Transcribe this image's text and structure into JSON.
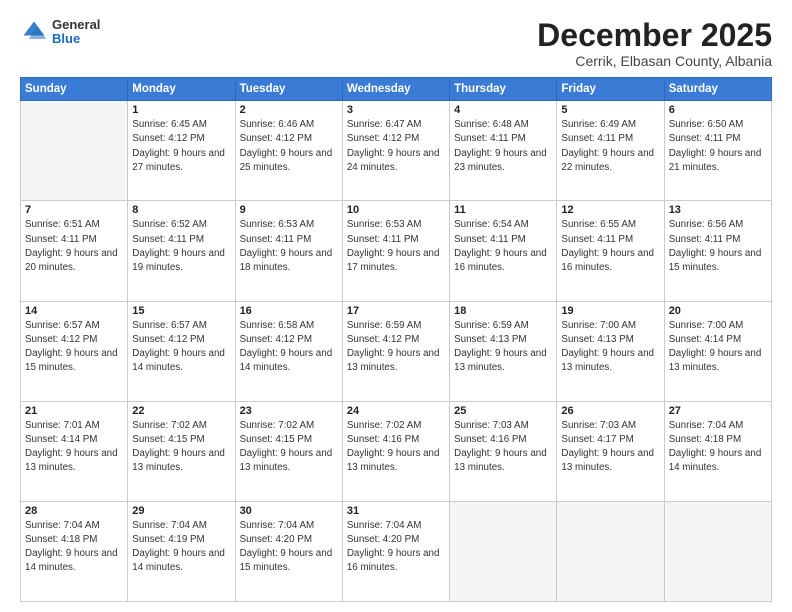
{
  "logo": {
    "general": "General",
    "blue": "Blue"
  },
  "header": {
    "month": "December 2025",
    "location": "Cerrik, Elbasan County, Albania"
  },
  "weekdays": [
    "Sunday",
    "Monday",
    "Tuesday",
    "Wednesday",
    "Thursday",
    "Friday",
    "Saturday"
  ],
  "weeks": [
    [
      {
        "day": "",
        "empty": true
      },
      {
        "day": "1",
        "sunrise": "6:45 AM",
        "sunset": "4:12 PM",
        "daylight": "9 hours and 27 minutes."
      },
      {
        "day": "2",
        "sunrise": "6:46 AM",
        "sunset": "4:12 PM",
        "daylight": "9 hours and 25 minutes."
      },
      {
        "day": "3",
        "sunrise": "6:47 AM",
        "sunset": "4:12 PM",
        "daylight": "9 hours and 24 minutes."
      },
      {
        "day": "4",
        "sunrise": "6:48 AM",
        "sunset": "4:11 PM",
        "daylight": "9 hours and 23 minutes."
      },
      {
        "day": "5",
        "sunrise": "6:49 AM",
        "sunset": "4:11 PM",
        "daylight": "9 hours and 22 minutes."
      },
      {
        "day": "6",
        "sunrise": "6:50 AM",
        "sunset": "4:11 PM",
        "daylight": "9 hours and 21 minutes."
      }
    ],
    [
      {
        "day": "7",
        "sunrise": "6:51 AM",
        "sunset": "4:11 PM",
        "daylight": "9 hours and 20 minutes."
      },
      {
        "day": "8",
        "sunrise": "6:52 AM",
        "sunset": "4:11 PM",
        "daylight": "9 hours and 19 minutes."
      },
      {
        "day": "9",
        "sunrise": "6:53 AM",
        "sunset": "4:11 PM",
        "daylight": "9 hours and 18 minutes."
      },
      {
        "day": "10",
        "sunrise": "6:53 AM",
        "sunset": "4:11 PM",
        "daylight": "9 hours and 17 minutes."
      },
      {
        "day": "11",
        "sunrise": "6:54 AM",
        "sunset": "4:11 PM",
        "daylight": "9 hours and 16 minutes."
      },
      {
        "day": "12",
        "sunrise": "6:55 AM",
        "sunset": "4:11 PM",
        "daylight": "9 hours and 16 minutes."
      },
      {
        "day": "13",
        "sunrise": "6:56 AM",
        "sunset": "4:11 PM",
        "daylight": "9 hours and 15 minutes."
      }
    ],
    [
      {
        "day": "14",
        "sunrise": "6:57 AM",
        "sunset": "4:12 PM",
        "daylight": "9 hours and 15 minutes."
      },
      {
        "day": "15",
        "sunrise": "6:57 AM",
        "sunset": "4:12 PM",
        "daylight": "9 hours and 14 minutes."
      },
      {
        "day": "16",
        "sunrise": "6:58 AM",
        "sunset": "4:12 PM",
        "daylight": "9 hours and 14 minutes."
      },
      {
        "day": "17",
        "sunrise": "6:59 AM",
        "sunset": "4:12 PM",
        "daylight": "9 hours and 13 minutes."
      },
      {
        "day": "18",
        "sunrise": "6:59 AM",
        "sunset": "4:13 PM",
        "daylight": "9 hours and 13 minutes."
      },
      {
        "day": "19",
        "sunrise": "7:00 AM",
        "sunset": "4:13 PM",
        "daylight": "9 hours and 13 minutes."
      },
      {
        "day": "20",
        "sunrise": "7:00 AM",
        "sunset": "4:14 PM",
        "daylight": "9 hours and 13 minutes."
      }
    ],
    [
      {
        "day": "21",
        "sunrise": "7:01 AM",
        "sunset": "4:14 PM",
        "daylight": "9 hours and 13 minutes."
      },
      {
        "day": "22",
        "sunrise": "7:02 AM",
        "sunset": "4:15 PM",
        "daylight": "9 hours and 13 minutes."
      },
      {
        "day": "23",
        "sunrise": "7:02 AM",
        "sunset": "4:15 PM",
        "daylight": "9 hours and 13 minutes."
      },
      {
        "day": "24",
        "sunrise": "7:02 AM",
        "sunset": "4:16 PM",
        "daylight": "9 hours and 13 minutes."
      },
      {
        "day": "25",
        "sunrise": "7:03 AM",
        "sunset": "4:16 PM",
        "daylight": "9 hours and 13 minutes."
      },
      {
        "day": "26",
        "sunrise": "7:03 AM",
        "sunset": "4:17 PM",
        "daylight": "9 hours and 13 minutes."
      },
      {
        "day": "27",
        "sunrise": "7:04 AM",
        "sunset": "4:18 PM",
        "daylight": "9 hours and 14 minutes."
      }
    ],
    [
      {
        "day": "28",
        "sunrise": "7:04 AM",
        "sunset": "4:18 PM",
        "daylight": "9 hours and 14 minutes."
      },
      {
        "day": "29",
        "sunrise": "7:04 AM",
        "sunset": "4:19 PM",
        "daylight": "9 hours and 14 minutes."
      },
      {
        "day": "30",
        "sunrise": "7:04 AM",
        "sunset": "4:20 PM",
        "daylight": "9 hours and 15 minutes."
      },
      {
        "day": "31",
        "sunrise": "7:04 AM",
        "sunset": "4:20 PM",
        "daylight": "9 hours and 16 minutes."
      },
      {
        "day": "",
        "empty": true
      },
      {
        "day": "",
        "empty": true
      },
      {
        "day": "",
        "empty": true
      }
    ]
  ]
}
